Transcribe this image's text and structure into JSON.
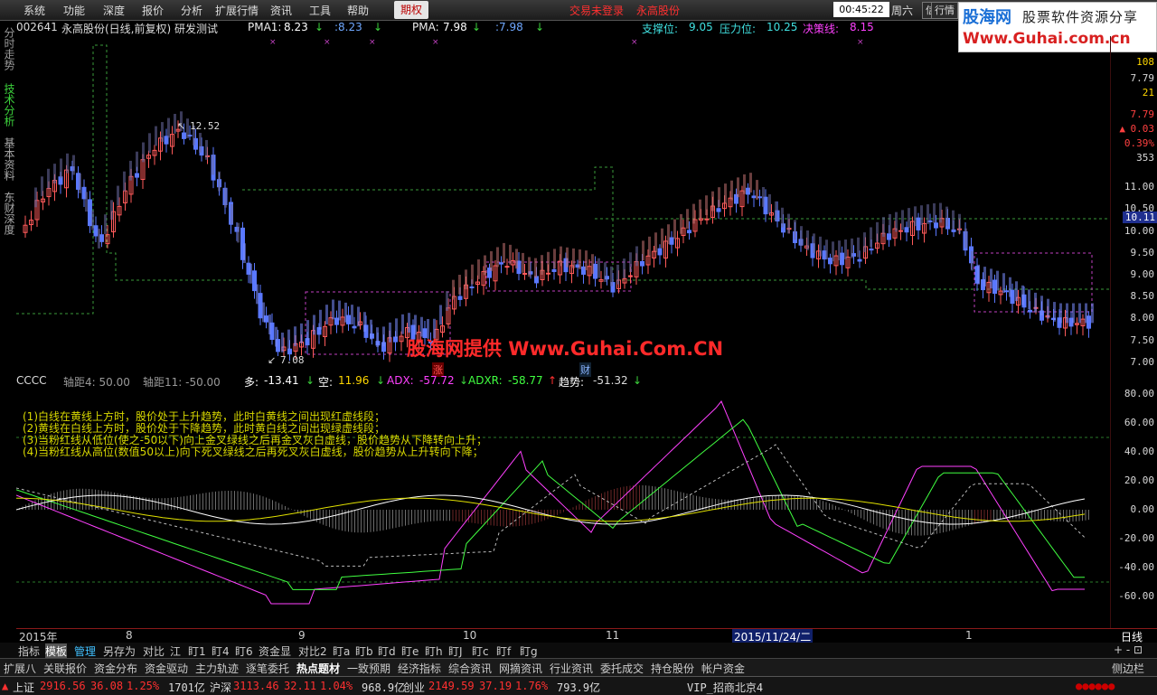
{
  "menubar": {
    "items": [
      "系统",
      "功能",
      "深度",
      "报价",
      "分析",
      "扩展行情",
      "资讯",
      "工具",
      "帮助"
    ],
    "active_tab": "期权",
    "trade_status": "交易未登录",
    "stock_name_top": "永高股份",
    "time": "00:45:22",
    "weekday": "周六",
    "btn_info": "信息",
    "btn_quote": "行情"
  },
  "logo": {
    "brand": "股海网",
    "slogan": "股票软件资源分享",
    "url": "Www.Guhai.com.cn"
  },
  "side_tabs": [
    "分时走势",
    "技术分析",
    "基本资料",
    "东财深度"
  ],
  "header": {
    "code": "002641",
    "title": "永高股份(日线,前复权) 研发测试",
    "pma1_label": "PMA1:",
    "pma1_val1": "8.23",
    "pma1_val2": ":8.23",
    "pma_label": "PMA:",
    "pma_val1": "7.98",
    "pma_val2": ":7.98",
    "support_label": "支撑位:",
    "support_val": "9.05",
    "pressure_label": "压力位:",
    "pressure_val": "10.25",
    "decision_label": "决策线:",
    "decision_val": "8.15"
  },
  "main_chart": {
    "high_label": "12.52",
    "low_label": "7.08",
    "marker_up": "涨",
    "marker_cai": "财",
    "axis": [
      "11.00",
      "10.50",
      "10.00",
      "9.50",
      "9.00",
      "8.50",
      "8.00",
      "7.50",
      "7.00"
    ],
    "price_tag": "10.11",
    "right_info": [
      "108",
      "7.79",
      "21",
      "7.79",
      "0.03",
      "0.39%",
      "353"
    ]
  },
  "indicator": {
    "name": "CCCC",
    "axis4": "轴距4: 50.00",
    "axis11": "轴距11: -50.00",
    "duo_label": "多:",
    "duo_val": "-13.41",
    "kong_label": "空:",
    "kong_val": "11.96",
    "adx_label": "ADX:",
    "adx_val": "-57.72",
    "adxr_label": "ADXR:",
    "adxr_val": "-58.77",
    "trend_label": "趋势:",
    "trend_val": "-51.32",
    "notes": [
      "(1)白线在黄线上方时，股价处于上升趋势，此时白黄线之间出现红虚线段；",
      "(2)黄线在白线上方时，股价处于下降趋势，此时黄白线之间出现绿虚线段；",
      "(3)当粉红线从低位(使之-50以下)向上金叉绿线之后再金叉灰白虚线，股价趋势从下降转向上升；",
      "(4)当粉红线从高位(数值50以上)向下死叉绿线之后再死叉灰白虚线，股价趋势从上升转向下降；"
    ],
    "axis": [
      "80.00",
      "60.00",
      "40.00",
      "20.00",
      "0.00",
      "-20.00",
      "-40.00",
      "-60.00"
    ]
  },
  "date_axis": {
    "labels": [
      "2015年",
      "8",
      "9",
      "10",
      "11",
      "2015/11/24/二",
      "1"
    ],
    "period": "日线"
  },
  "toolbar1": [
    "指标",
    "模板",
    "管理",
    "另存为",
    "对比",
    "江",
    "盯1",
    "盯4",
    "盯6",
    "资金显",
    "对比2",
    "盯a",
    "盯b",
    "盯d",
    "盯e",
    "盯h",
    "盯J",
    "盯c",
    "盯f",
    "盯g"
  ],
  "toolbar2": [
    "扩展八",
    "关联报价",
    "资金分布",
    "资金驱动",
    "主力轨迹",
    "逐笔委托",
    "热点题材",
    "一致预期",
    "经济指标",
    "综合资讯",
    "网摘资讯",
    "行业资讯",
    "委托成交",
    "持仓股份",
    "帐户资金"
  ],
  "toolbar2_right": "侧边栏",
  "statusbar": {
    "sh_label": "上证",
    "sh_val": "2916.56",
    "sh_chg": "36.08",
    "sh_pct": "1.25%",
    "sh_amt": "1701亿",
    "hs_label": "沪深",
    "hs_val": "3113.46",
    "hs_chg": "32.11",
    "hs_pct": "1.04%",
    "hs_amt": "968.9亿",
    "cy_label": "创业",
    "cy_val": "2149.59",
    "cy_chg": "37.19",
    "cy_pct": "1.76%",
    "cy_amt": "793.9亿",
    "vip": "VIP_招商北京4"
  },
  "watermark": "股海网提供 Www.Guhai.Com.CN",
  "colors": {
    "up": "#ff5a5a",
    "down": "#5a78ff",
    "pink": "#ff40ff",
    "green": "#40ff40",
    "yellow": "#e0e000",
    "cyan": "#40e0e0"
  }
}
